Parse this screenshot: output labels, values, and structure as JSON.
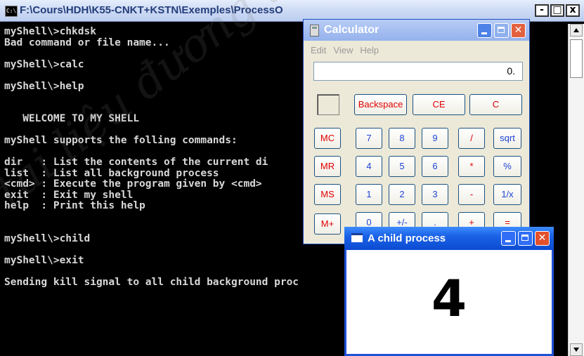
{
  "console": {
    "title": "F:\\Cours\\HDH\\K55-CNKT+KSTN\\Exemples\\ProcessO",
    "icon": "cmd-icon",
    "buttons": {
      "min": "-",
      "max": "□",
      "close": "x"
    },
    "lines": [
      "myShell\\>chkdsk",
      "Bad command or file name...",
      "",
      "myShell\\>calc",
      "",
      "myShell\\>help",
      "",
      "",
      "   WELCOME TO MY SHELL",
      "",
      "myShell supports the folling commands:",
      "",
      "dir   : List the contents of the current di",
      "list  : List all background process",
      "<cmd> : Execute the program given by <cmd>",
      "exit  : Exit my shell",
      "help  : Print this help",
      "",
      "",
      "myShell\\>child",
      "",
      "myShell\\>exit",
      "",
      "Sending kill signal to all child background proc"
    ]
  },
  "calculator": {
    "title": "Calculator",
    "menu": [
      "Edit",
      "View",
      "Help"
    ],
    "display": "0.",
    "buttons": {
      "backspace": "Backspace",
      "ce": "CE",
      "c": "C",
      "mc": "MC",
      "mr": "MR",
      "ms": "MS",
      "mplus": "M+",
      "b7": "7",
      "b8": "8",
      "b9": "9",
      "div": "/",
      "sqrt": "sqrt",
      "b4": "4",
      "b5": "5",
      "b6": "6",
      "mul": "*",
      "pct": "%",
      "b1": "1",
      "b2": "2",
      "b3": "3",
      "sub": "-",
      "inv": "1/x",
      "b0": "0",
      "sign": "+/-",
      "dot": ".",
      "add": "+",
      "eq": "="
    }
  },
  "child": {
    "title": "A child process",
    "value": "4"
  }
}
